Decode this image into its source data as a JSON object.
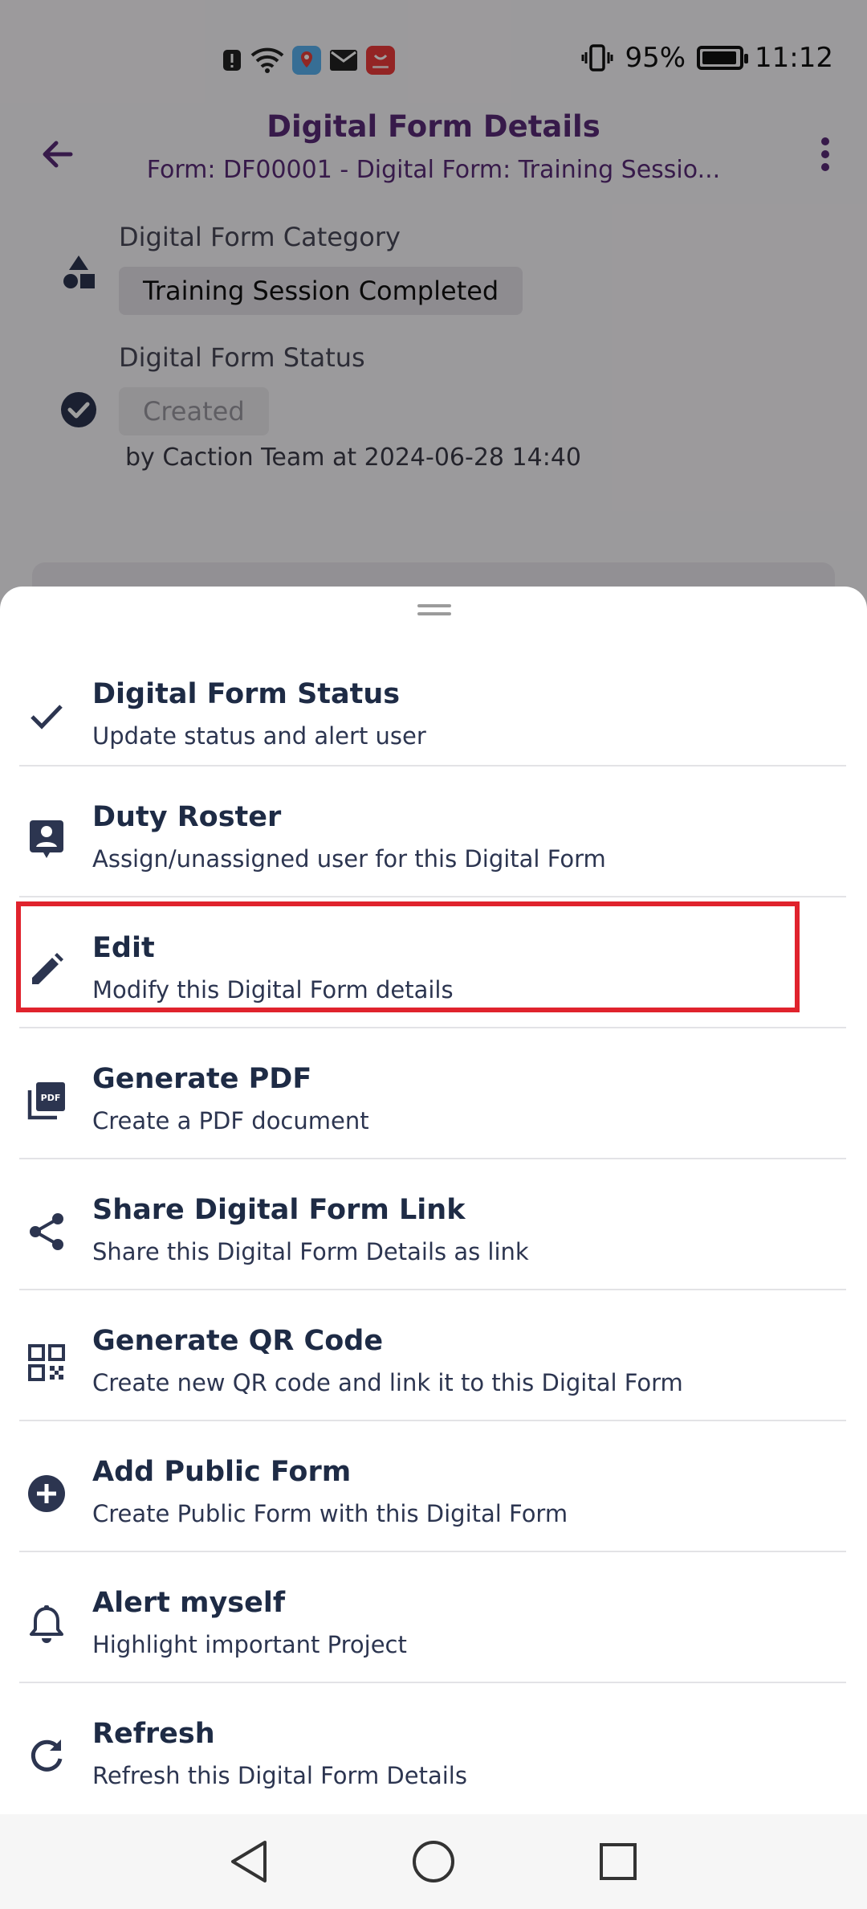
{
  "status_bar": {
    "battery": "95%",
    "time": "11:12",
    "battery_level": 0.95,
    "icons": [
      "alert-icon",
      "wifi-icon",
      "location-app-icon",
      "mail-icon",
      "huawei-app-icon",
      "vibrate-icon",
      "battery-icon"
    ]
  },
  "app_bar": {
    "title": "Digital Form Details",
    "subtitle": "Form: DF00001 - Digital Form: Training Sessio...",
    "back_icon": "arrow-back-icon",
    "more_icon": "more-vert-icon"
  },
  "details": {
    "category_label": "Digital Form Category",
    "category_value": "Training Session Completed",
    "status_label": "Digital Form Status",
    "status_value": "Created",
    "by_line": "by Caction Team at 2024-06-28 14:40"
  },
  "sheet": {
    "items": [
      {
        "title": "Digital Form Status",
        "subtitle": "Update status and alert user",
        "icon": "check-icon"
      },
      {
        "title": "Duty Roster",
        "subtitle": "Assign/unassigned user for this Digital Form",
        "icon": "contact-card-icon"
      },
      {
        "title": "Edit",
        "subtitle": "Modify this Digital Form details",
        "icon": "pencil-icon"
      },
      {
        "title": "Generate PDF",
        "subtitle": "Create a PDF document",
        "icon": "pdf-icon"
      },
      {
        "title": "Share Digital Form Link",
        "subtitle": "Share this Digital Form Details as link",
        "icon": "share-icon"
      },
      {
        "title": "Generate QR Code",
        "subtitle": "Create new QR code and link it to this Digital Form",
        "icon": "qr-code-icon"
      },
      {
        "title": "Add Public Form",
        "subtitle": "Create Public Form with this Digital Form",
        "icon": "add-circle-icon"
      },
      {
        "title": "Alert myself",
        "subtitle": "Highlight important Project",
        "icon": "bell-icon"
      },
      {
        "title": "Refresh",
        "subtitle": "Refresh this Digital Form Details",
        "icon": "refresh-icon"
      }
    ],
    "highlighted_item": "Edit"
  },
  "colors": {
    "accent": "#5a2a78",
    "menu_text": "#1e2b45",
    "highlight": "#e0232d"
  },
  "nav_bar": {
    "icons": [
      "nav-back-icon",
      "nav-home-icon",
      "nav-recents-icon"
    ]
  }
}
